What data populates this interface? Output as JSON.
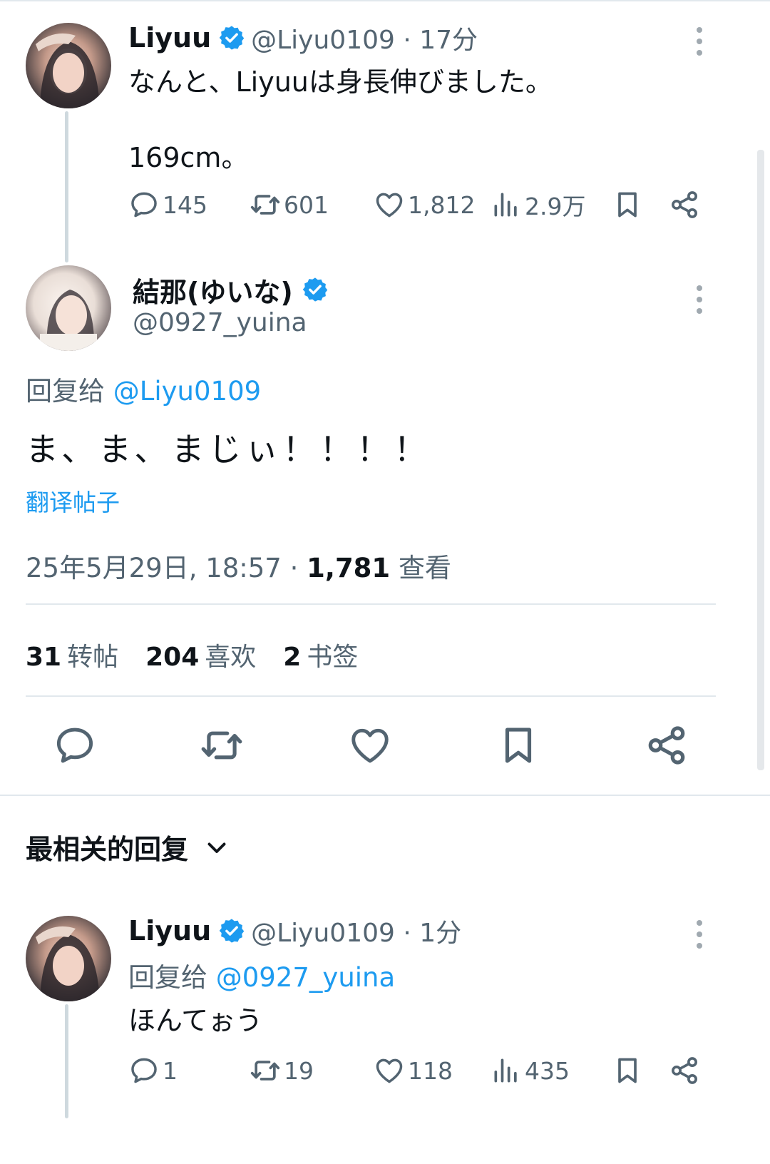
{
  "post1": {
    "name": "Liyuu",
    "handle_time": "@Liyu0109 · 17分",
    "text_line1": "なんと、Liyuuは身長伸びました。",
    "text_line2": "169cm。",
    "reply_count": "145",
    "retweet_count": "601",
    "like_count": "1,812",
    "view_count": "2.9万"
  },
  "main_post": {
    "name": "結那(ゆいな)",
    "handle": "@0927_yuina",
    "reply_to_label": "回复给",
    "reply_to_handle": "@Liyu0109",
    "text": "ま、ま、まじぃ！！！！",
    "translate_label": "翻译帖子",
    "timestamp": "25年5月29日, 18:57 · ",
    "views_number": "1,781",
    "views_label": " 查看",
    "stats": {
      "retweets_num": "31",
      "retweets_label": "转帖",
      "likes_num": "204",
      "likes_label": "喜欢",
      "bookmarks_num": "2",
      "bookmarks_label": "书签"
    }
  },
  "replies_header": {
    "label": "最相关的回复"
  },
  "reply1": {
    "name": "Liyuu",
    "handle_time": "@Liyu0109 · 1分",
    "reply_to_label": "回复给",
    "reply_to_handle": "@0927_yuina",
    "text": "ほんてぉう",
    "reply_count": "1",
    "retweet_count": "19",
    "like_count": "118",
    "view_count": "435"
  },
  "colors": {
    "accent": "#1d9bf0",
    "muted": "#536471",
    "text": "#0f1419",
    "divider": "#e1e8ed"
  },
  "icons": [
    "verified-badge-icon",
    "more-icon",
    "reply-icon",
    "retweet-icon",
    "like-icon",
    "views-icon",
    "bookmark-icon",
    "share-icon",
    "chevron-down-icon"
  ]
}
